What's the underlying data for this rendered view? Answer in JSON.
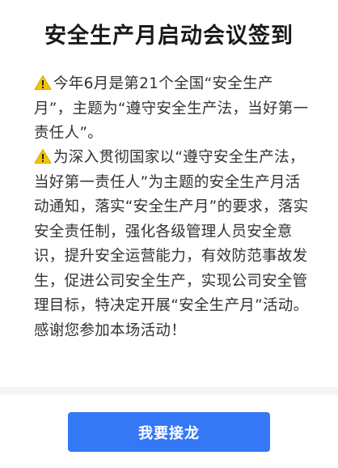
{
  "page": {
    "title": "安全生产月启动会议签到"
  },
  "notice": {
    "icon": "warning-icon",
    "icon_color": "#f5c400",
    "paragraph_1": "今年6月是第21个全国“安全生产月”，主题为“遵守安全生产法，当好第一责任人”。",
    "paragraph_2": "为深入贯彻国家以“遵守安全生产法，当好第一责任人”为主题的安全生产月活动通知，落实“安全生产月”的要求，落实安全责任制，强化各级管理人员安全意识，提升安全运营能力，有效防范事故发生，促进公司安全生产，实现公司安全管理目标，特决定开展“安全生产月”活动。感谢您参加本场活动！"
  },
  "actions": {
    "signin_label": "我要接龙",
    "button_color": "#3478f6"
  }
}
